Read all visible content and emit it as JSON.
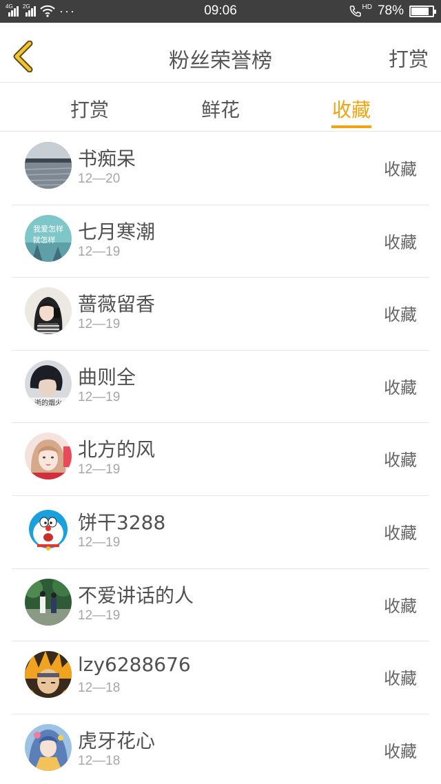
{
  "status_bar": {
    "network_1": "4G",
    "network_2": "2G",
    "more": "···",
    "time": "09:06",
    "hd": "HD",
    "battery_pct": "78%",
    "battery_level": 0.78
  },
  "header": {
    "title": "粉丝荣誉榜",
    "action": "打赏",
    "back_icon": "chevron-left-icon",
    "accent_color": "#f0a410"
  },
  "tabs": [
    {
      "label": "打赏",
      "active": false
    },
    {
      "label": "鲜花",
      "active": false
    },
    {
      "label": "收藏",
      "active": true
    }
  ],
  "fans": [
    {
      "name": "书痴呆",
      "date": "12—20",
      "type": "收藏"
    },
    {
      "name": "七月寒潮",
      "date": "12—19",
      "type": "收藏",
      "avatar_text_1": "我爱怎样",
      "avatar_text_2": "就怎样"
    },
    {
      "name": "蔷薇留香",
      "date": "12—19",
      "type": "收藏"
    },
    {
      "name": "曲则全",
      "date": "12—19",
      "type": "收藏",
      "avatar_text_1": "逝的烟火"
    },
    {
      "name": "北方的风",
      "date": "12—19",
      "type": "收藏"
    },
    {
      "name": "饼干3288",
      "date": "12—19",
      "type": "收藏"
    },
    {
      "name": "不爱讲话的人",
      "date": "12—19",
      "type": "收藏"
    },
    {
      "name": "lzy6288676",
      "date": "12—18",
      "type": "收藏"
    },
    {
      "name": "虎牙花心",
      "date": "12—18",
      "type": "收藏"
    }
  ]
}
